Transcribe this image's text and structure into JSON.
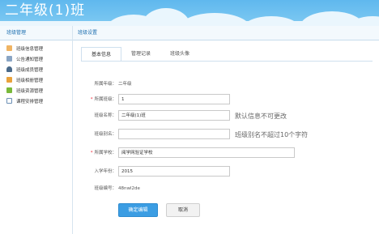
{
  "header": {
    "title": "二年级(1)班"
  },
  "sidebar": {
    "title": "班级管理",
    "items": [
      {
        "label": "班级信息管理",
        "icon": "document-icon",
        "color": "#f0b463"
      },
      {
        "label": "公告通知管理",
        "icon": "notice-icon",
        "color": "#8aa5c4"
      },
      {
        "label": "班级成员管理",
        "icon": "person-icon",
        "color": "#4a6a8a"
      },
      {
        "label": "班级相册管理",
        "icon": "album-icon",
        "color": "#e9a23b"
      },
      {
        "label": "班级资源管理",
        "icon": "resource-icon",
        "color": "#79b93a"
      },
      {
        "label": "课程安排管理",
        "icon": "schedule-icon",
        "color": "#6b8fb5"
      }
    ]
  },
  "main": {
    "section_title": "班级设置",
    "tabs": [
      "基本信息",
      "管理记录",
      "班级头像"
    ],
    "form": {
      "grade_label": "所属年级：",
      "grade_value": "二年级",
      "class_label": "所属班级：",
      "class_value": "1",
      "name_label": "班级名称：",
      "name_value": "二年级(1)班",
      "name_hint": "默认信息不可更改",
      "alias_label": "班级别名：",
      "alias_value": "",
      "alias_hint": "班级别名不超过10个字符",
      "school_label": "所属学校：",
      "school_value": "阅学网验证学校",
      "year_label": "入学年份：",
      "year_value": "2015",
      "code_label": "班级编号：",
      "code_value": "48nwl2de"
    },
    "buttons": {
      "confirm": "确定编辑",
      "cancel": "取消"
    }
  }
}
